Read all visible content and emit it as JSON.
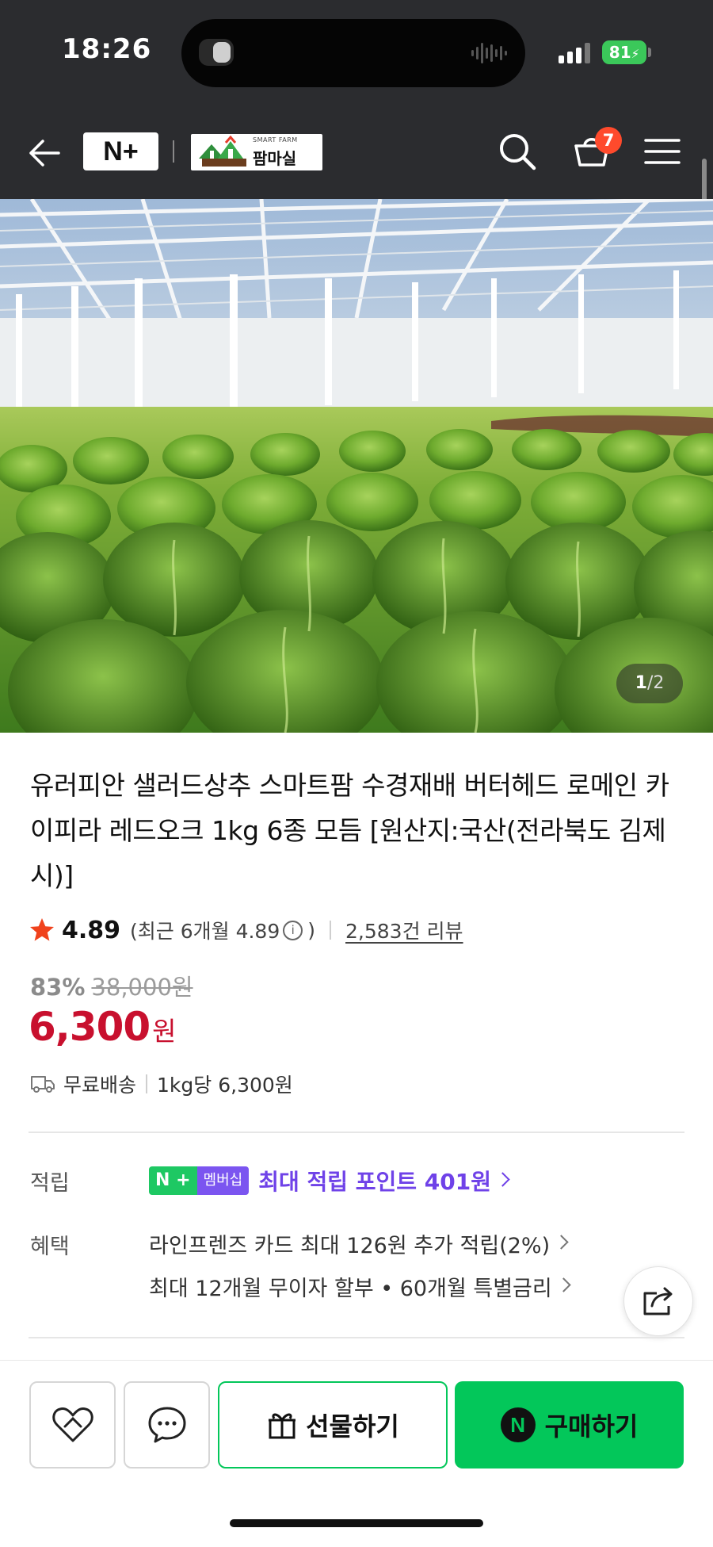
{
  "status_bar": {
    "time": "18:26",
    "battery": "81"
  },
  "header": {
    "logo_text": "N+",
    "store_logo_sub": "SMART FARM",
    "store_logo_name": "팜마실",
    "cart_count": "7"
  },
  "gallery": {
    "current": "1",
    "separator": "/",
    "total": "2"
  },
  "product": {
    "title": "유러피안 샐러드상추 스마트팜 수경재배 버터헤드 로메인 카이피라 레드오크 1kg 6종 모듬 [원산지:국산(전라북도 김제시)]",
    "rating": "4.89",
    "rating_recent": "(최근 6개월 4.89",
    "rating_recent_close": ")",
    "review_count": "2,583건 리뷰",
    "discount": "83%",
    "original_price": "38,000원",
    "price": "6,300",
    "price_unit": "원",
    "shipping": "무료배송",
    "unit_price": "1kg당 6,300원"
  },
  "benefits": {
    "points_label": "적립",
    "member_badge_left": "N +",
    "member_badge_right": "멤버십",
    "points_text": "최대 적립 포인트 401원",
    "benefit_label": "혜택",
    "card_benefit": "라인프렌즈 카드 최대 126원 추가 적립(2%)",
    "installment": "최대 12개월 무이자 할부 • 60개월 특별금리"
  },
  "actions": {
    "gift_label": "선물하기",
    "buy_label": "구매하기",
    "buy_logo": "N"
  },
  "colors": {
    "naver_green": "#03c75a",
    "price_red": "#c8102e",
    "points_purple": "#6f42e8",
    "badge_red": "#ff4a2c"
  }
}
